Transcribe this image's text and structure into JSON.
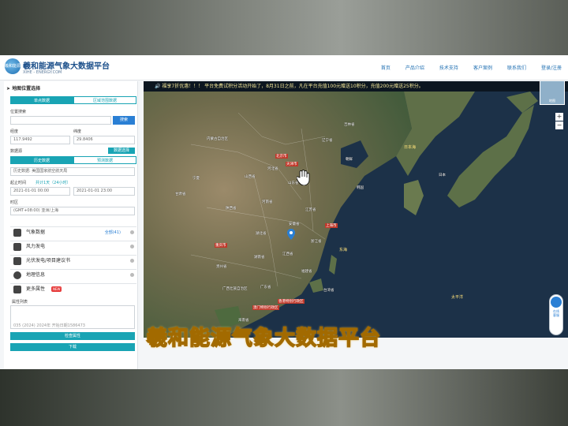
{
  "app": {
    "brand": "羲和能源气象大数据平台",
    "brand_sub": "XIHE - ENERGY.COM",
    "logo_text": "羲和能源"
  },
  "nav": [
    "首页",
    "产品介绍",
    "技术支持",
    "客户案例",
    "联系我们",
    "登录/注册"
  ],
  "panel": {
    "title": "地图位置选择",
    "tabs": [
      "单点数据",
      "区域范围数据"
    ],
    "location_search_label": "位置搜索",
    "search_button": "搜索",
    "lon_label": "经度",
    "lat_label": "纬度",
    "lon_value": "117.9492",
    "lat_value": "29.8406",
    "data_source_label": "数据源",
    "source_btn": "数据选择",
    "data_tabs": [
      "历史数据",
      "预测数据"
    ],
    "dataset_value": "历史数据: 美国国家航空航天局",
    "period_label": "起止时间",
    "period_hint": "共计1天（24小时）",
    "start_time": "2021-01-01 00:00",
    "end_time": "2021-01-01 23:00",
    "timezone_label": "时区",
    "timezone_value": "(GMT+08:00) 亚洲/上海",
    "sections": [
      {
        "label": "气象数据",
        "extra": "全部(41)"
      },
      {
        "label": "风力发电",
        "extra": ""
      },
      {
        "label": "光伏发电/项目建议书",
        "extra": ""
      },
      {
        "label": "地理信息",
        "extra": ""
      },
      {
        "label": "更多属性",
        "extra": ""
      }
    ],
    "new_badge": "NEW",
    "attr_list_label": "属性列表",
    "attr_preview": "035 (2024) 2024年 开始日期1586473",
    "btn_confirm": "检查属性",
    "btn_download": "下载"
  },
  "map": {
    "ticker": "福享7折优惠！！！ 平台免费试积分活动开始了，8月31日之前，凡在平台充值100元赠送10积分，充值200元赠送25积分。",
    "caption": "羲和能源气象大数据平台",
    "province_labels": [
      "北京市",
      "天津市",
      "河北省",
      "山西省",
      "山东省",
      "河南省",
      "陕西省",
      "江苏省",
      "安徽省",
      "湖北省",
      "浙江省",
      "江西省",
      "湖南省",
      "福建省",
      "贵州省",
      "广西壮族自治区",
      "广东省",
      "香港特别行政区",
      "澳门特别行政区",
      "台湾省",
      "海南省",
      "韩国",
      "朝鲜",
      "日本",
      "辽宁省",
      "吉林省",
      "内蒙古自治区",
      "宁夏",
      "甘肃省",
      "上海市",
      "重庆市"
    ],
    "sea_labels": [
      "日本海",
      "东海",
      "太平洋"
    ],
    "sidebar_tool": "在线客服",
    "thumb_label": "地图"
  }
}
